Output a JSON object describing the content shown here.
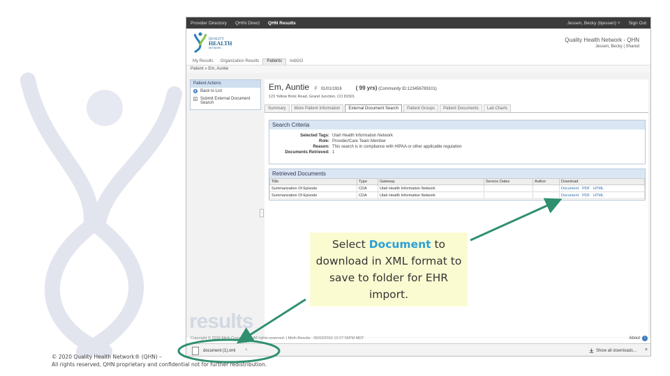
{
  "topnav": {
    "items": [
      "Provider Directory",
      "QHIN Direct",
      "QHN Results"
    ],
    "active_index": 2,
    "user": "Jessen, Becky (bjessen) ˅",
    "signout": "Sign Out"
  },
  "header": {
    "brand": "Quality Health Network - QHN",
    "brand_sub": "Jessen, Becky | Shared",
    "logo_text": "QUALITY HEALTH NETWORK"
  },
  "subnav": {
    "items": [
      "My Results",
      "Organization Results",
      "Patients",
      "IndiGO"
    ],
    "active_index": 2
  },
  "breadcrumb": "Patient » Em, Auntie",
  "sidebar": {
    "title": "Patient Actions",
    "actions": [
      "Back to List",
      "Submit External Document Search"
    ]
  },
  "patient": {
    "name": "Em, Auntie",
    "sex": "F",
    "dob": "01/01/1916",
    "age": "( 99 yrs)",
    "community": "(Community ID:123456789101)",
    "address": "123 Yellow Brick Road, Grand Junction, CO 81501"
  },
  "tabs": [
    "Summary",
    "More Patient Information",
    "External Document Search",
    "Patient Groups",
    "Patient Documents",
    "Lab Charts"
  ],
  "active_tab": 2,
  "search_criteria": {
    "title": "Search Criteria",
    "rows": [
      {
        "label": "Selected Tags:",
        "value": "Utah Health Information Network"
      },
      {
        "label": "Role:",
        "value": "Provider/Care Team Member"
      },
      {
        "label": "Reason:",
        "value": "This search is in compliance with HIPAA or other applicable regulation"
      },
      {
        "label": "Documents Retrieved:",
        "value": "1"
      }
    ]
  },
  "retrieved": {
    "title": "Retrieved Documents",
    "columns": [
      "Title",
      "Type",
      "Gateway",
      "Service Dates",
      "Author",
      "Download"
    ],
    "rows": [
      {
        "title": "Summarization Of Episode",
        "type": "CDA",
        "gateway": "Utah Health Information Network",
        "dates": "",
        "author": "",
        "links": [
          "Document",
          "PDF",
          "HTML"
        ]
      },
      {
        "title": "Summarization Of Episode",
        "type": "CDA",
        "gateway": "Utah Health Information Network",
        "dates": "",
        "author": "",
        "links": [
          "Document",
          "PDF",
          "HTML"
        ]
      }
    ]
  },
  "footer": {
    "text": "Copyright © 2016 Mirth Corporation. All rights reserved. | Mirth Results : 05/03/2016 12:27:55PM MDT",
    "about": "About",
    "watermark": "results"
  },
  "download_bar": {
    "filename": "document (1).xml",
    "caret": "^",
    "show_all": "Show all downloads...",
    "close": "×"
  },
  "callout": {
    "pre": "Select ",
    "highlight": "Document",
    "post": " to download in XML format to save to folder for EHR import."
  },
  "copyright": {
    "line1": "© 2020 Quality Health Network® (QHN) –",
    "line2": "All rights reserved, QHN proprietary and confidential not for further redistribution."
  },
  "colors": {
    "accent": "#2a9fd6",
    "arrow": "#2f8f6f",
    "callout_bg": "#fbfbd2",
    "link": "#2f6fb3"
  }
}
